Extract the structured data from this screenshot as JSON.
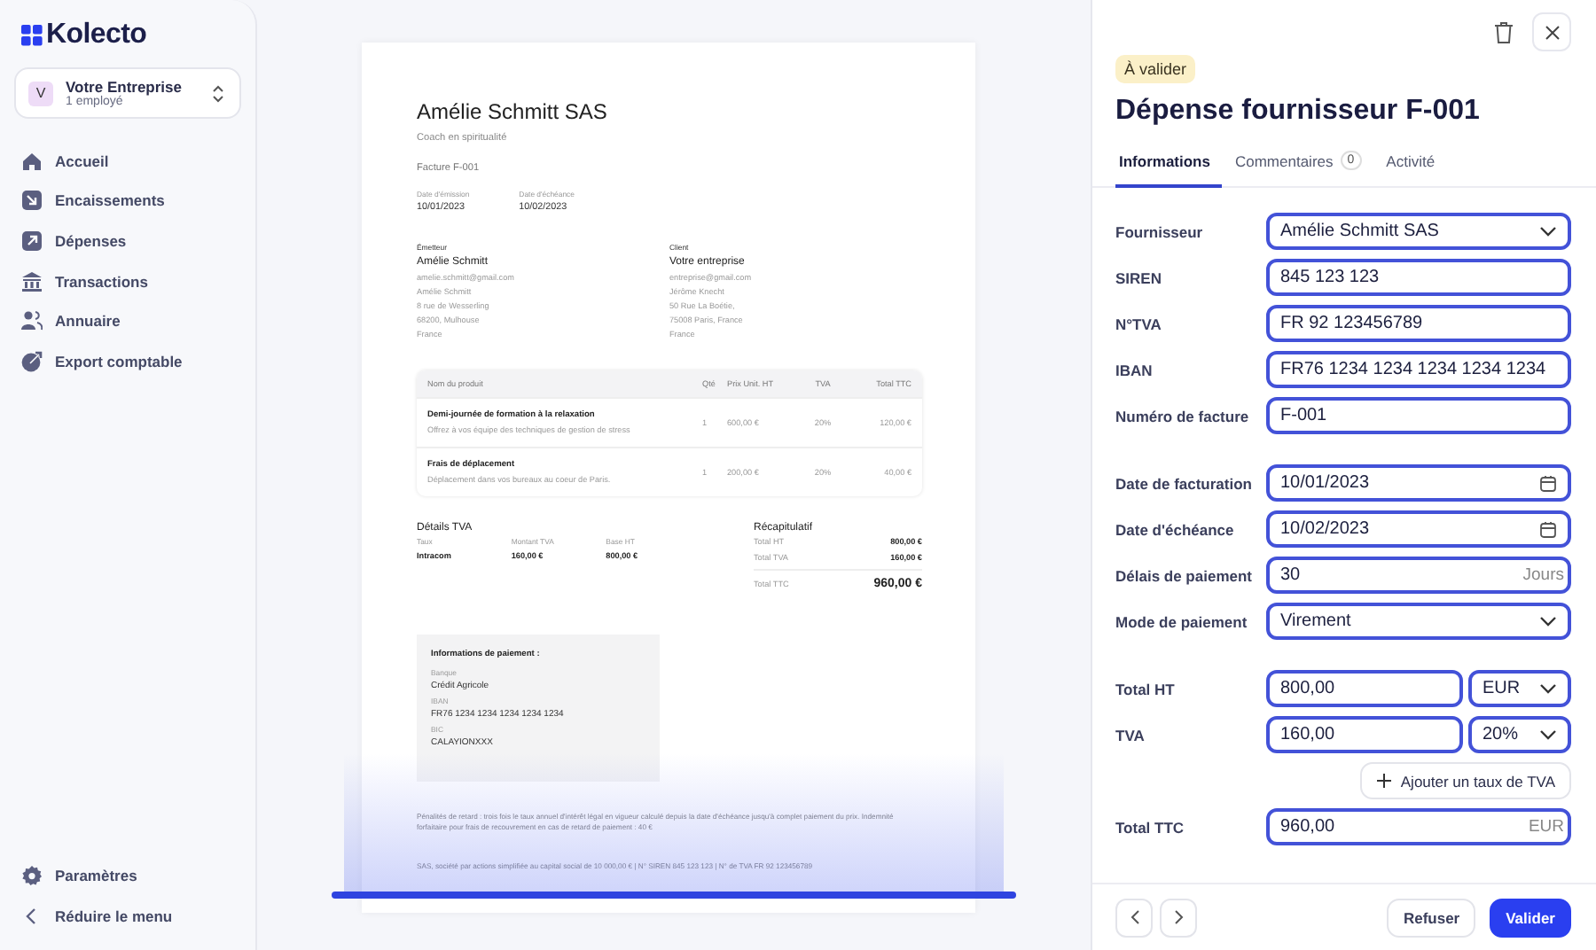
{
  "sidebar": {
    "logo": "Kolecto",
    "company": {
      "initial": "V",
      "name": "Votre Entreprise",
      "subtitle": "1 employé"
    },
    "items": [
      {
        "label": "Accueil"
      },
      {
        "label": "Encaissements"
      },
      {
        "label": "Dépenses"
      },
      {
        "label": "Transactions"
      },
      {
        "label": "Annuaire"
      },
      {
        "label": "Export comptable"
      }
    ],
    "bottom_items": [
      {
        "label": "Paramètres"
      },
      {
        "label": "Réduire le menu"
      }
    ]
  },
  "invoice": {
    "company": "Amélie Schmitt SAS",
    "tagline": "Coach en spiritualité",
    "number": "Facture F-001",
    "dates": [
      {
        "label": "Date d'émission",
        "value": "10/01/2023"
      },
      {
        "label": "Date d'échéance",
        "value": "10/02/2023"
      }
    ],
    "parties": [
      {
        "role": "Émetteur",
        "name": "Amélie Schmitt",
        "lines": [
          "amelie.schmitt@gmail.com",
          "Amélie Schmitt",
          "8 rue de Wesserling",
          "68200, Mulhouse",
          "France"
        ]
      },
      {
        "role": "Client",
        "name": "Votre entreprise",
        "lines": [
          "entreprise@gmail.com",
          "Jérôme Knecht",
          "50 Rue La Boétie,",
          "75008 Paris, France",
          "France"
        ]
      }
    ],
    "table": {
      "columns": [
        "Nom du produit",
        "Qté",
        "Prix Unit. HT",
        "TVA",
        "Total TTC"
      ],
      "rows": [
        {
          "name": "Demi-journée de formation à la relaxation",
          "description": "Offrez à vos équipe des techniques de gestion de stress",
          "qty": "1",
          "unit_price": "600,00 €",
          "tva": "20%",
          "total": "120,00 €"
        },
        {
          "name": "Frais de déplacement",
          "description": "Déplacement dans vos bureaux au coeur de Paris.",
          "qty": "1",
          "unit_price": "200,00 €",
          "tva": "20%",
          "total": "40,00 €"
        }
      ]
    },
    "tva_details": {
      "title": "Détails TVA",
      "columns": [
        {
          "label": "Taux",
          "value": "Intracom"
        },
        {
          "label": "Montant TVA",
          "value": "160,00 €"
        },
        {
          "label": "Base HT",
          "value": "800,00 €"
        }
      ]
    },
    "summary": {
      "title": "Récapitulatif",
      "rows": [
        {
          "label": "Total HT",
          "value": "800,00 €"
        },
        {
          "label": "Total TVA",
          "value": "160,00 €"
        }
      ],
      "total": {
        "label": "Total TTC",
        "value": "960,00 €"
      }
    },
    "payment": {
      "title": "Informations de paiement :",
      "items": [
        {
          "label": "Banque",
          "value": "Crédit Agricole"
        },
        {
          "label": "IBAN",
          "value": "FR76 1234 1234 1234 1234 1234"
        },
        {
          "label": "BIC",
          "value": "CALAYIONXXX"
        }
      ]
    },
    "legal": [
      "Pénalités de retard : trois fois le taux annuel d'intérêt légal en vigueur calculé depuis la date d'échéance jusqu'à complet paiement du prix. Indemnité forfaitaire pour frais de recouvrement en cas de retard de paiement : 40 €",
      "SAS, société par actions simplifiée au capital social de 10 000,00 € | N° SIREN 845 123 123 | N° de TVA FR 92 123456789"
    ]
  },
  "panel": {
    "status": "À valider",
    "title": "Dépense fournisseur F-001",
    "tabs": [
      {
        "label": "Informations",
        "selected": true
      },
      {
        "label": "Commentaires",
        "count": "0",
        "selected": false
      },
      {
        "label": "Activité",
        "selected": false
      }
    ],
    "sections": [
      {
        "fields": [
          {
            "label": "Fournisseur",
            "kind": "select",
            "value": "Amélie Schmitt SAS"
          },
          {
            "label": "SIREN",
            "kind": "text",
            "value": "845 123 123"
          },
          {
            "label": "N°TVA",
            "kind": "text",
            "value": "FR 92 123456789"
          },
          {
            "label": "IBAN",
            "kind": "text",
            "value": "FR76 1234 1234 1234 1234 1234"
          },
          {
            "label": "Numéro de facture",
            "kind": "text",
            "value": "F-001"
          }
        ]
      },
      {
        "fields": [
          {
            "label": "Date de facturation",
            "kind": "date",
            "value": "10/01/2023"
          },
          {
            "label": "Date d'échéance",
            "kind": "date",
            "value": "10/02/2023"
          },
          {
            "label": "Délais de paiement",
            "kind": "suffix",
            "value": "30",
            "suffix": "Jours"
          },
          {
            "label": "Mode de paiement",
            "kind": "select",
            "value": "Virement"
          }
        ]
      },
      {
        "fields": [
          {
            "label": "Total HT",
            "kind": "split",
            "value": "800,00",
            "option": "EUR"
          },
          {
            "label": "TVA",
            "kind": "split",
            "value": "160,00",
            "option": "20%"
          },
          {
            "kind": "add",
            "label": "Ajouter un taux de TVA"
          },
          {
            "label": "Total TTC",
            "kind": "suffix",
            "value": "960,00",
            "suffix": "EUR"
          }
        ]
      }
    ],
    "buttons": [
      {
        "label": "Refuser",
        "kind": "secondary"
      },
      {
        "label": "Valider",
        "kind": "primary"
      }
    ]
  }
}
